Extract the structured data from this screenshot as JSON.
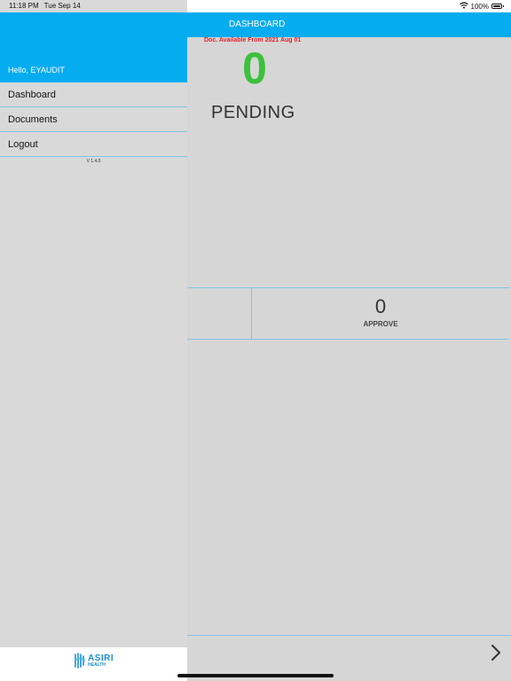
{
  "status_bar": {
    "time": "11:18 PM",
    "date": "Tue Sep 14",
    "battery": "100%"
  },
  "sidebar": {
    "greeting": "Hello, EYAUDIT",
    "items": [
      {
        "label": "Dashboard"
      },
      {
        "label": "Documents"
      },
      {
        "label": "Logout"
      }
    ],
    "version": "V 1.4.0",
    "logo": {
      "name": "ASIRI",
      "sub": "HEALTH"
    }
  },
  "header": {
    "title": "DASHBOARD"
  },
  "dashboard": {
    "availability": "Doc. Available From 2021 Aug 01",
    "pending_count": "0",
    "pending_label": "PENDING",
    "approve_count": "0",
    "approve_label": "APPROVE"
  },
  "colors": {
    "accent": "#05acef",
    "pending": "#3cc13c",
    "alert": "#e0202a",
    "divider": "#7fc4e3"
  },
  "icons": {
    "wifi": "wifi-icon",
    "battery": "battery-icon",
    "next": "chevron-right-icon",
    "logo": "asiri-health-logo-icon"
  }
}
